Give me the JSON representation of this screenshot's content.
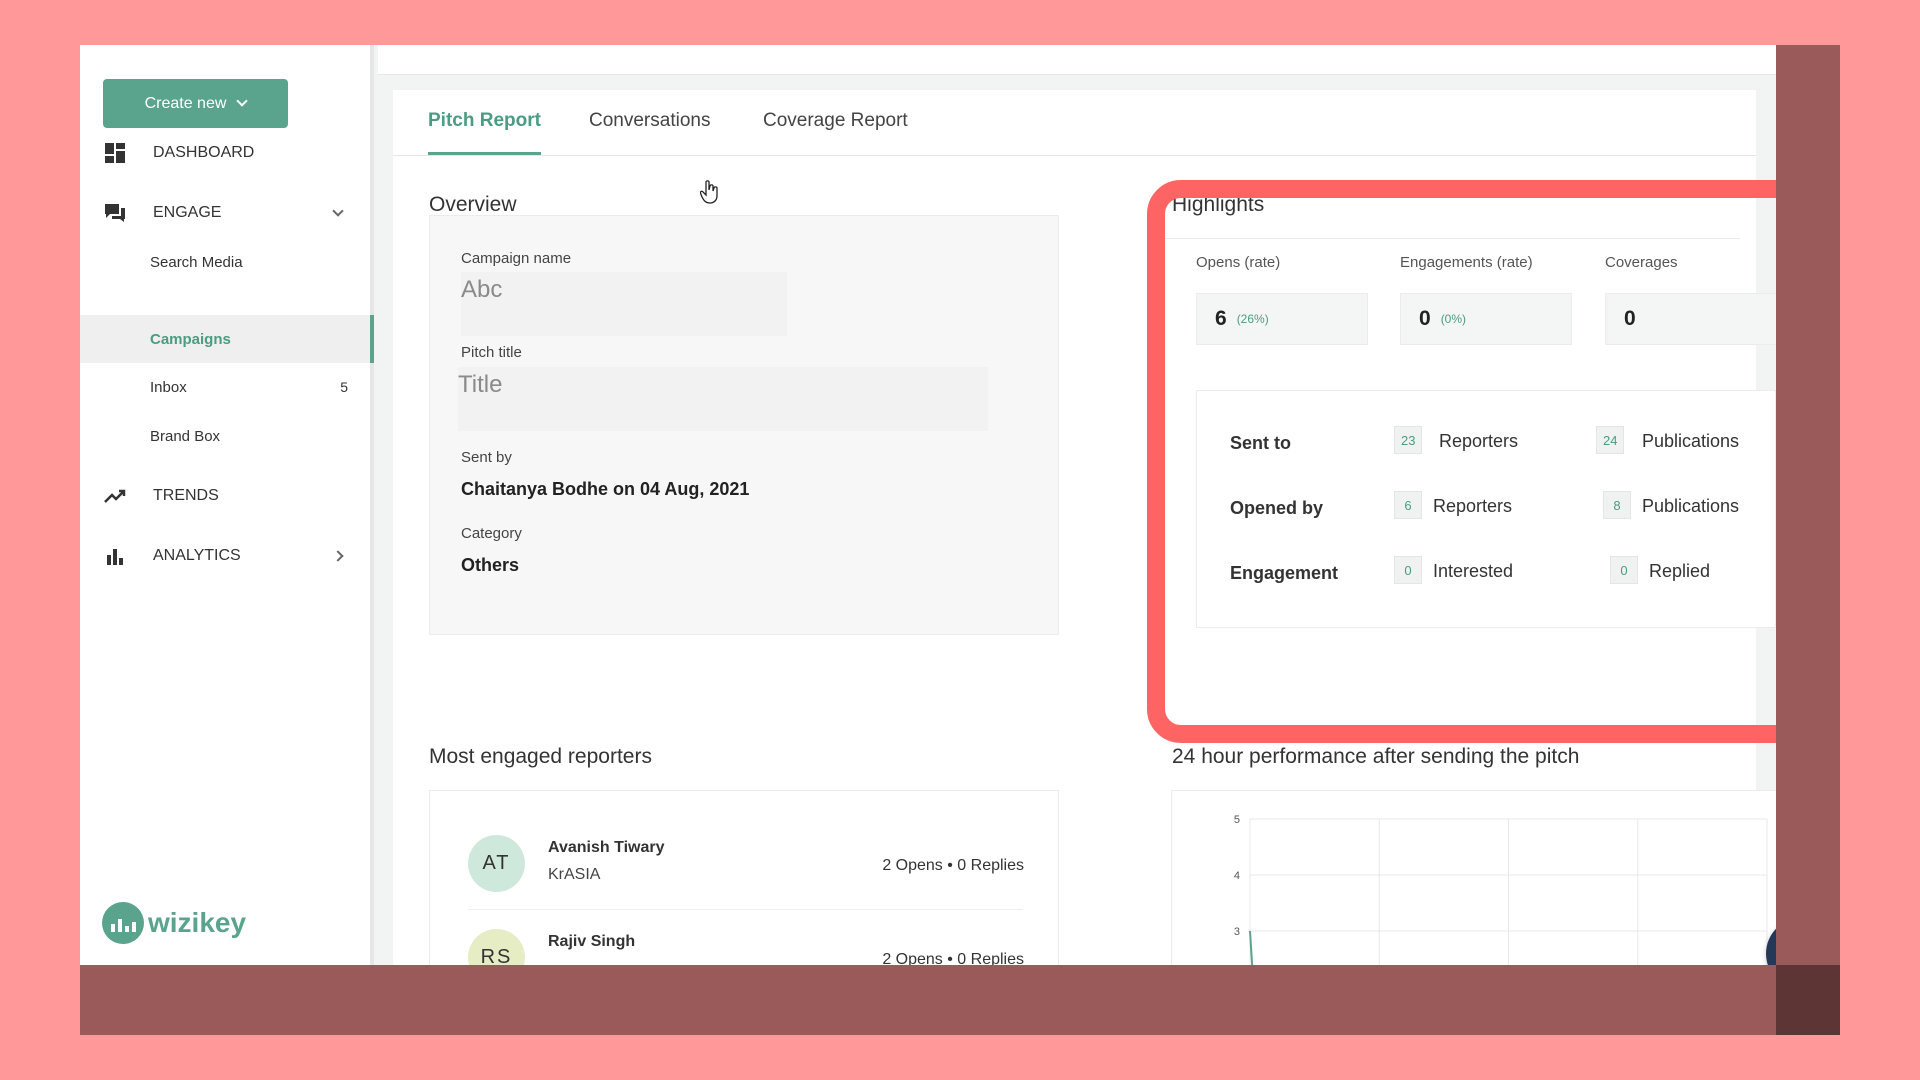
{
  "sidebar": {
    "create_label": "Create new",
    "nav": {
      "dashboard": "DASHBOARD",
      "engage": "ENGAGE",
      "search_media": "Search Media",
      "campaigns": "Campaigns",
      "inbox": "Inbox",
      "inbox_count": "5",
      "brand_box": "Brand Box",
      "trends": "TRENDS",
      "analytics": "ANALYTICS"
    },
    "logo": "wizikey"
  },
  "tabs": {
    "pitch_report": "Pitch Report",
    "conversations": "Conversations",
    "coverage_report": "Coverage Report",
    "active": "pitch_report"
  },
  "overview": {
    "title": "Overview",
    "campaign_name_label": "Campaign name",
    "campaign_name_value": "Abc",
    "pitch_title_label": "Pitch title",
    "pitch_title_value": "Title",
    "sent_by_label": "Sent by",
    "sent_by_value": "Chaitanya Bodhe on 04 Aug, 2021",
    "category_label": "Category",
    "category_value": "Others"
  },
  "highlights": {
    "title": "Highlights",
    "opens_label": "Opens (rate)",
    "opens_value": "6",
    "opens_rate": "(26%)",
    "engagements_label": "Engagements (rate)",
    "engagements_value": "0",
    "engagements_rate": "(0%)",
    "coverages_label": "Coverages",
    "coverages_value": "0",
    "sent_to_label": "Sent to",
    "sent_to_reporters": "23",
    "sent_to_publications": "24",
    "opened_by_label": "Opened by",
    "opened_by_reporters": "6",
    "opened_by_publications": "8",
    "engagement_label": "Engagement",
    "engagement_interested": "0",
    "engagement_replied": "0",
    "reporters_label": "Reporters",
    "publications_label": "Publications",
    "interested_label": "Interested",
    "replied_label": "Replied"
  },
  "reporters": {
    "title": "Most engaged reporters",
    "items": [
      {
        "initials": "AT",
        "name": "Avanish Tiwary",
        "publication": "KrASIA",
        "stats": "2 Opens  •  0 Replies",
        "avatar_color": "#cfe8dc"
      },
      {
        "initials": "RS",
        "name": "Rajiv Singh",
        "publication": "",
        "stats": "2 Opens  •  0 Replies",
        "avatar_color": "#e6ecc4"
      }
    ]
  },
  "performance": {
    "title": "24 hour performance after sending the pitch"
  },
  "chart_data": {
    "type": "line",
    "title": "24 hour performance after sending the pitch",
    "xlabel": "",
    "ylabel": "",
    "y_ticks": [
      "5",
      "4",
      "3"
    ],
    "series": [
      {
        "values": []
      }
    ],
    "grid": true
  },
  "colors": {
    "accent": "#5aa38c",
    "highlight_frame": "#ff6464",
    "chat_button": "#253857"
  }
}
